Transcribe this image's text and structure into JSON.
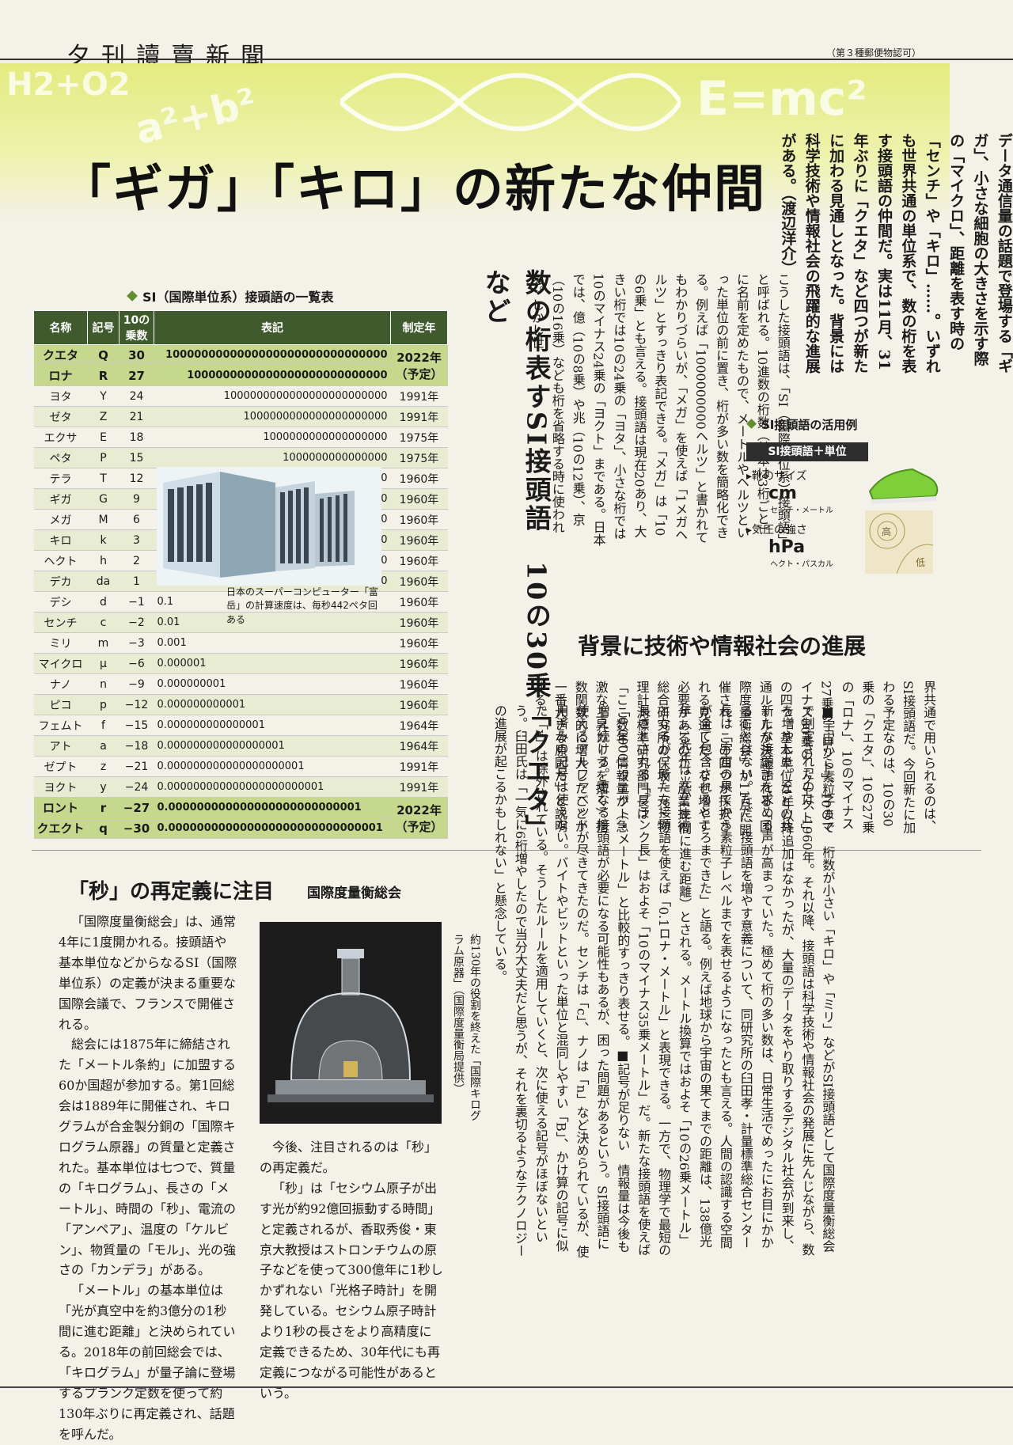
{
  "masthead": {
    "title": "夕刊讀賣新聞",
    "note": "（第３種郵便物認可）"
  },
  "band": {
    "formula_left": "H2+O2",
    "formula_mid": "a²+b²",
    "formula_right": "E=mc²"
  },
  "headline": "「ギガ」「キロ」の新たな仲間",
  "lead": "データ通信量の話題で登場する「ギガ」、小さな細胞の大きさを示す際の「マイクロ」、距離を表す時の「センチ」や「キロ」……。いずれも世界共通の単位系で、数の桁を表す接頭語の仲間だ。実は11月、31年ぶりに「クエタ」など四つが新たに加わる見通しとなった。背景には科学技術や情報社会の飛躍的な進展がある。（渡辺洋介）",
  "subhead": "数の桁表すSI接頭語　10の30乗「クエタ」など",
  "table": {
    "title": "SI（国際単位系）接頭語の一覧表",
    "headers": [
      "名称",
      "記号",
      "10の乗数",
      "表記",
      "制定年"
    ],
    "rows": [
      {
        "name": "クエタ",
        "symbol": "Q",
        "exp": "30",
        "notation": "1000000000000000000000000000000",
        "year": "2022年（予定）",
        "style": "new"
      },
      {
        "name": "ロナ",
        "symbol": "R",
        "exp": "27",
        "notation": "1000000000000000000000000000",
        "year": "",
        "style": "new"
      },
      {
        "name": "ヨタ",
        "symbol": "Y",
        "exp": "24",
        "notation": "1000000000000000000000000",
        "year": "1991年",
        "style": ""
      },
      {
        "name": "ゼタ",
        "symbol": "Z",
        "exp": "21",
        "notation": "1000000000000000000000",
        "year": "1991年",
        "style": "shade"
      },
      {
        "name": "エクサ",
        "symbol": "E",
        "exp": "18",
        "notation": "1000000000000000000",
        "year": "1975年",
        "style": ""
      },
      {
        "name": "ペタ",
        "symbol": "P",
        "exp": "15",
        "notation": "1000000000000000",
        "year": "1975年",
        "style": "shade"
      },
      {
        "name": "テラ",
        "symbol": "T",
        "exp": "12",
        "notation": "1000000000000",
        "year": "1960年",
        "style": ""
      },
      {
        "name": "ギガ",
        "symbol": "G",
        "exp": "9",
        "notation": "1000000000",
        "year": "1960年",
        "style": "shade"
      },
      {
        "name": "メガ",
        "symbol": "M",
        "exp": "6",
        "notation": "1000000",
        "year": "1960年",
        "style": ""
      },
      {
        "name": "キロ",
        "symbol": "k",
        "exp": "3",
        "notation": "1000",
        "year": "1960年",
        "style": "shade"
      },
      {
        "name": "ヘクト",
        "symbol": "h",
        "exp": "2",
        "notation": "100",
        "year": "1960年",
        "style": ""
      },
      {
        "name": "デカ",
        "symbol": "da",
        "exp": "1",
        "notation": "10",
        "year": "1960年",
        "style": "shade"
      },
      {
        "name": "デシ",
        "symbol": "d",
        "exp": "−1",
        "notation": "0.1",
        "year": "1960年",
        "style": "neg"
      },
      {
        "name": "センチ",
        "symbol": "c",
        "exp": "−2",
        "notation": "0.01",
        "year": "1960年",
        "style": "neg shade"
      },
      {
        "name": "ミリ",
        "symbol": "m",
        "exp": "−3",
        "notation": "0.001",
        "year": "1960年",
        "style": "neg"
      },
      {
        "name": "マイクロ",
        "symbol": "μ",
        "exp": "−6",
        "notation": "0.000001",
        "year": "1960年",
        "style": "neg shade"
      },
      {
        "name": "ナノ",
        "symbol": "n",
        "exp": "−9",
        "notation": "0.000000001",
        "year": "1960年",
        "style": "neg"
      },
      {
        "name": "ピコ",
        "symbol": "p",
        "exp": "−12",
        "notation": "0.000000000001",
        "year": "1960年",
        "style": "neg shade"
      },
      {
        "name": "フェムト",
        "symbol": "f",
        "exp": "−15",
        "notation": "0.000000000000001",
        "year": "1964年",
        "style": "neg"
      },
      {
        "name": "アト",
        "symbol": "a",
        "exp": "−18",
        "notation": "0.000000000000000001",
        "year": "1964年",
        "style": "neg shade"
      },
      {
        "name": "ゼプト",
        "symbol": "z",
        "exp": "−21",
        "notation": "0.000000000000000000001",
        "year": "1991年",
        "style": "neg"
      },
      {
        "name": "ヨクト",
        "symbol": "y",
        "exp": "−24",
        "notation": "0.000000000000000000000001",
        "year": "1991年",
        "style": "neg shade"
      },
      {
        "name": "ロント",
        "symbol": "r",
        "exp": "−27",
        "notation": "0.000000000000000000000000001",
        "year": "2022年（予定）",
        "style": "neg new"
      },
      {
        "name": "クエクト",
        "symbol": "q",
        "exp": "−30",
        "notation": "0.000000000000000000000000000001",
        "year": "",
        "style": "neg new"
      }
    ]
  },
  "computer_caption": "日本のスーパーコンピューター「富岳」の計算速度は、毎秒442ペタ回ある",
  "body1": "こうした接頭語は、「SI（国際単位系）接頭語」と呼ばれる。10進数の桁数（基本は3桁ごと）に名前を定めたもので、メートルやヘルツといった単位の前に置き、桁が多い数を簡略化できる。例えば「1000000000ヘルツ」と書かれてもわかりづらいが、「メガ」を使えば「1メガヘルツ」とすっきり表記できる。「メガ」は「10の6乗」とも言える。接頭語は現在20あり、大きい桁では10の24乗の「ヨタ」、小さな桁では10のマイナス24乗の「ヨクト」まである。日本では、億（10の8乗）や兆（10の12乗）、京（10の16乗）なども桁を省略する時に使われる。しかし世",
  "usage": {
    "title": "SI接頭語の活用例",
    "bar": "SI接頭語＋単位",
    "item1_label": "▸靴のサイズ",
    "item1_unit": "cm",
    "item1_ruby": "センチ・メートル",
    "item2_label": "▸気圧の強さ",
    "item2_unit": "hPa",
    "item2_ruby": "ヘクト・パスカル",
    "map_high": "高",
    "map_low": "低"
  },
  "section_head": "背景に技術や情報社会の進展",
  "body2": "界共通で用いられるのは、SI接頭語だ。今回新たに加わる予定なのは、10の30乗の「クエタ」、10の27乗の「ロナ」、10のマイナス27乗の「ロント」、10のマイナス30乗の「クエクト」の四つ。基本単位などの共通ルールが決議される「国際度量衡総会」が11月に開催され、この四つが採択される見通しだ。なぜ増やす必要があるのか。産業技術総合研究所の保坂一元・物理計測標準研究部門長は「ここ数年、情報量が（急激な上昇カーブを描く）指数関数的に増大したことが一番大きな原因だ」と説明する。",
  "lower_cols": "■宇宙から素粒子まで　桁数が小さい「キロ」や「ミリ」などがSI接頭語として国際度量衡総会で制定されたのは、1960年。それ以降、接頭語は科学技術や情報社会の発展に先んじながら、数を増やした。91年以降追加はなかったが、大量のデータをやり取りするデジタル社会が到来し、新たな接頭語を求める声が高まっていた。極めて桁の多い数は、日常生活でめったにお目にかかることはない。ただ、接頭語を増やす意義について、同研究所の臼田孝・計量標準総合センター長は「宇宙の果てから素粒子レベルまでを表せるようになったとも言える。人間の認識する空間が全て包含されるところまできた」と語る。例えば地球から宇宙の果てまでの距離は、138億光年（1光年は光が1年間に進む距離）とされる。メートル換算ではおよそ「10の26乗メートル」となるが、新たな接頭語を使えば「0.1ロナ・メートル」と表現できる。一方で、物理学で最短の長さとされる「プランク長」はおよそ「10のマイナス35乗メートル」だ。新たな接頭語を使えば「0.00001クエクト・メートル」と比較的すっきり表せる。■記号が足りない　情報量は今後も増え続ける。更なる接頭語が必要になる可能性もあるが、困った問題があるという。SI接頭語に使えるアルファベットが尽きてきたのだ。センチは「c」、ナノは「n」など決められているが、使用済みの記号は使えない。バイトやビットといった単位と混同しやすい「B」、かけ算の記号に似た「x」は除外されている。そうしたルールを適用していくと、次に使える記号がほぼないという。臼田氏は「一気に6桁増やしたので当分大丈夫だと思うが、それを裏切るようなテクノロジーの進展が起こるかもしれない」と懸念している。",
  "second": {
    "title": "「秒」の再定義に注目",
    "subtitle": "国際度量衡総会",
    "p1": "「国際度量衡総会」は、通常4年に1度開かれる。接頭語や基本単位などからなるSI（国際単位系）の定義が決まる重要な国際会議で、フランスで開催される。",
    "p2": "総会には1875年に締結された「メートル条約」に加盟する60か国超が参加する。第1回総会は1889年に開催され、キログラムが合金製分銅の「国際キログラム原器」の質量と定義された。基本単位は七つで、質量の「キログラム」、長さの「メートル」、時間の「秒」、電流の「アンペア」、温度の「ケルビン」、物質量の「モル」、光の強さの「カンデラ」がある。",
    "p3": "「メートル」の基本単位は「光が真空中を約3億分の1秒間に進む距離」と決められている。2018年の前回総会では、「キログラム」が量子論に登場するプランク定数を使って約130年ぶりに再定義され、話題を呼んだ。",
    "kilo_caption": "約130年の役割を終えた「国際キログラム原器」（国際度量衡局提供）",
    "p4": "今後、注目されるのは「秒」の再定義だ。",
    "p5": "「秒」は「セシウム原子が出す光が約92億回振動する時間」と定義されるが、香取秀俊・東京大教授はストロンチウムの原子などを使って300億年に1秒しかずれない「光格子時計」を開発している。セシウム原子時計より1秒の長さをより高精度に定義できるため、30年代にも再定義につながる可能性があるという。"
  },
  "colors": {
    "header_green": "#3f5b2e",
    "new_row": "#c6d88e",
    "band": "#e3eb7f"
  }
}
